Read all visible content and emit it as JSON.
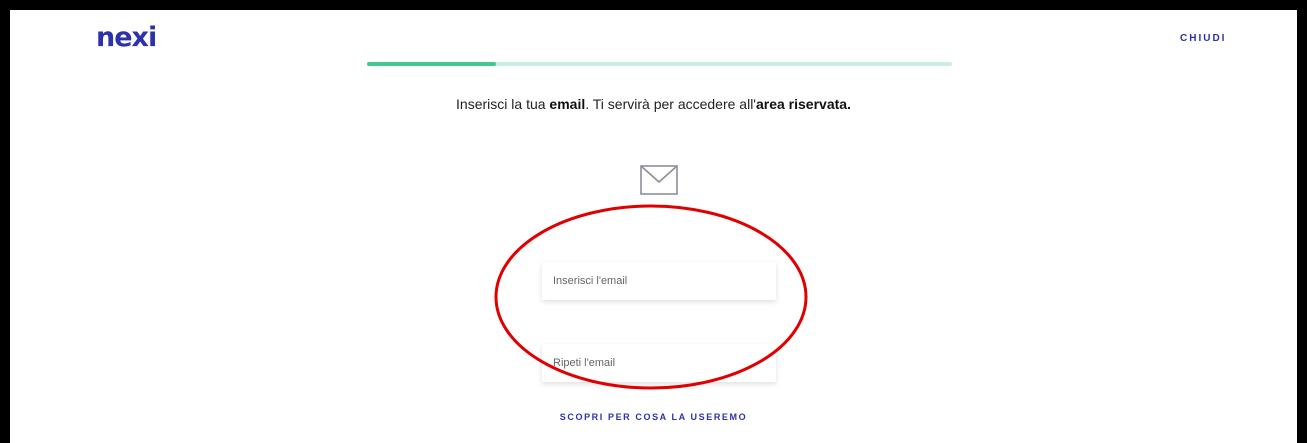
{
  "header": {
    "logo": "nexi",
    "close_label": "CHIUDI"
  },
  "progress": {
    "value": 0.22
  },
  "instruction": {
    "part1": "Inserisci la tua ",
    "email_bold": "email",
    "part2": ". Ti servirà per accedere all'",
    "area_bold": "area riservata."
  },
  "form": {
    "email_placeholder": "Inserisci l'email",
    "confirm_placeholder": "Ripeti l'email"
  },
  "discover_link": "SCOPRI PER COSA LA USEREMO",
  "colors": {
    "brand": "#2d32aa",
    "progress_fill": "#42c88e",
    "progress_track": "#c6efe2",
    "annotation": "#e00000"
  },
  "icons": {
    "mail": "envelope-icon"
  }
}
